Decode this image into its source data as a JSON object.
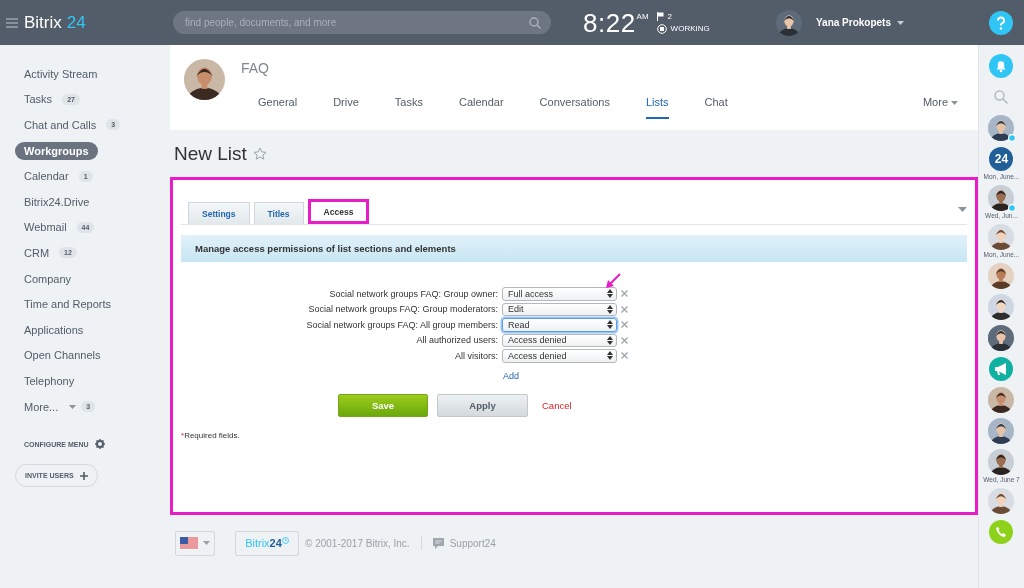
{
  "header": {
    "logo": {
      "word": "Bitrix",
      "number": "24"
    },
    "search": {
      "placeholder": "find people, documents, and more"
    },
    "clock": {
      "time": "8:22",
      "period": "AM"
    },
    "flag_count": "2",
    "work_status": "WORKING",
    "user": {
      "name": "Yana Prokopets"
    }
  },
  "sidebar": {
    "items": [
      {
        "label": "Activity Stream",
        "selected": false
      },
      {
        "label": "Tasks",
        "count": "27",
        "selected": false
      },
      {
        "label": "Chat and Calls",
        "count": "3",
        "selected": false
      },
      {
        "label": "Workgroups",
        "selected": true
      },
      {
        "label": "Calendar",
        "count": "1",
        "selected": false
      },
      {
        "label": "Bitrix24.Drive",
        "selected": false
      },
      {
        "label": "Webmail",
        "count": "44",
        "selected": false
      },
      {
        "label": "CRM",
        "count": "12",
        "selected": false
      },
      {
        "label": "Company",
        "selected": false
      },
      {
        "label": "Time and Reports",
        "selected": false
      },
      {
        "label": "Applications",
        "selected": false
      },
      {
        "label": "Open Channels",
        "selected": false
      },
      {
        "label": "Telephony",
        "selected": false
      },
      {
        "label": "More...",
        "count": "3",
        "selected": false,
        "dropdown": true
      }
    ],
    "configure": "CONFIGURE MENU",
    "invite": "INVITE USERS"
  },
  "group": {
    "name": "FAQ",
    "tabs": [
      {
        "label": "General",
        "selected": false
      },
      {
        "label": "Drive",
        "selected": false
      },
      {
        "label": "Tasks",
        "selected": false
      },
      {
        "label": "Calendar",
        "selected": false
      },
      {
        "label": "Conversations",
        "selected": false
      },
      {
        "label": "Lists",
        "selected": true
      },
      {
        "label": "Chat",
        "selected": false
      }
    ],
    "more": "More"
  },
  "page": {
    "title": "New List",
    "starred": false
  },
  "form": {
    "highlighted": true,
    "tabs": [
      {
        "label": "Settings",
        "selected": false,
        "highlighted": false
      },
      {
        "label": "Titles",
        "selected": false,
        "highlighted": false
      },
      {
        "label": "Access",
        "selected": true,
        "highlighted": true
      }
    ],
    "section_title": "Manage access permissions of list sections and elements",
    "permissions": [
      {
        "subject": "Social network groups FAQ: Group owner:",
        "value": "Full access",
        "focused": false,
        "marked": true
      },
      {
        "subject": "Social network groups FAQ: Group moderators:",
        "value": "Edit",
        "focused": false,
        "marked": false
      },
      {
        "subject": "Social network groups FAQ: All group members:",
        "value": "Read",
        "focused": true,
        "marked": false
      },
      {
        "subject": "All authorized users:",
        "value": "Access denied",
        "focused": false,
        "marked": false
      },
      {
        "subject": "All visitors:",
        "value": "Access denied",
        "focused": false,
        "marked": false
      }
    ],
    "add_link": "Add",
    "buttons": [
      {
        "label": "Save",
        "kind": "primary"
      },
      {
        "label": "Apply",
        "kind": "secondary"
      },
      {
        "label": "Cancel",
        "kind": "link"
      }
    ],
    "required_mark": "*",
    "required_text": "Required fields."
  },
  "footer": {
    "logo": {
      "word": "Bitrix",
      "number": "24"
    },
    "copyright": "© 2001-2017 Bitrix, Inc.",
    "support": "Support24"
  },
  "rail": [
    {
      "kind": "bell"
    },
    {
      "kind": "search"
    },
    {
      "kind": "avatar",
      "badge": true
    },
    {
      "kind": "logo",
      "text": "24",
      "label": "Mon, June..."
    },
    {
      "kind": "avatar",
      "badge": true,
      "label": "Wed, Jun..."
    },
    {
      "kind": "avatar",
      "badge": false,
      "label": "Mon, June..."
    },
    {
      "kind": "avatar",
      "badge": false
    },
    {
      "kind": "avatar",
      "badge": false
    },
    {
      "kind": "avatar",
      "badge": false
    },
    {
      "kind": "megaphone"
    },
    {
      "kind": "avatar",
      "badge": false
    },
    {
      "kind": "avatar",
      "badge": false
    },
    {
      "kind": "avatar",
      "badge": false,
      "label": "Wed, June 7"
    },
    {
      "kind": "avatar",
      "badge": false
    },
    {
      "kind": "phone"
    }
  ]
}
